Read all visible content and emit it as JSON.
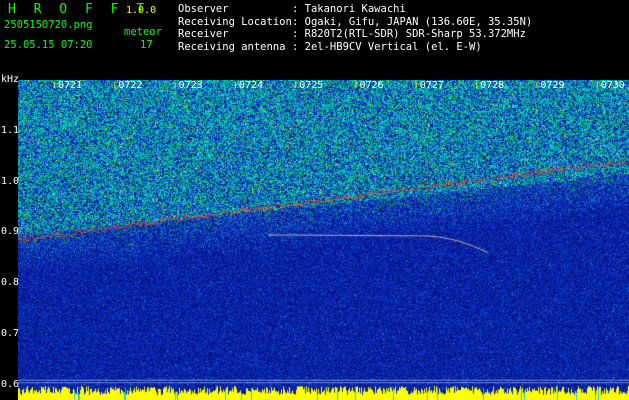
{
  "header": {
    "app_title": "H R O F F T",
    "version": "1.0.0",
    "filename": "2505150720.png",
    "datetime": "25.05.15 07:20",
    "meteor_label": "meteor",
    "meteor_count": "17"
  },
  "station_info": [
    {
      "label": "Observer",
      "value": ": Takanori Kawachi"
    },
    {
      "label": "Receiving Location",
      "value": ": Ogaki, Gifu, JAPAN (136.60E, 35.35N)"
    },
    {
      "label": "Receiver",
      "value": ": R820T2(RTL-SDR) SDR-Sharp 53.372MHz"
    },
    {
      "label": "Receiving antenna",
      "value": ": 2el-HB9CV Vertical (el. E-W)"
    }
  ],
  "spectrogram": {
    "unit_label": "kHz",
    "x_ticks": [
      "0721",
      "0722",
      "0723",
      "0724",
      "0725",
      "0726",
      "0727",
      "0728",
      "0729",
      "0730"
    ],
    "y_ticks": [
      "1.1",
      "1.0",
      "0.9",
      "0.8",
      "0.7",
      "0.6"
    ],
    "y_range": [
      0.57,
      1.2
    ],
    "colors": {
      "background": "#0a1aa0",
      "noise_high": "#00c8d0",
      "noise_mid": "#10a050",
      "trace": "#ff3030",
      "carrier": "#ffff00",
      "tick_marker": "#ffff00"
    }
  }
}
